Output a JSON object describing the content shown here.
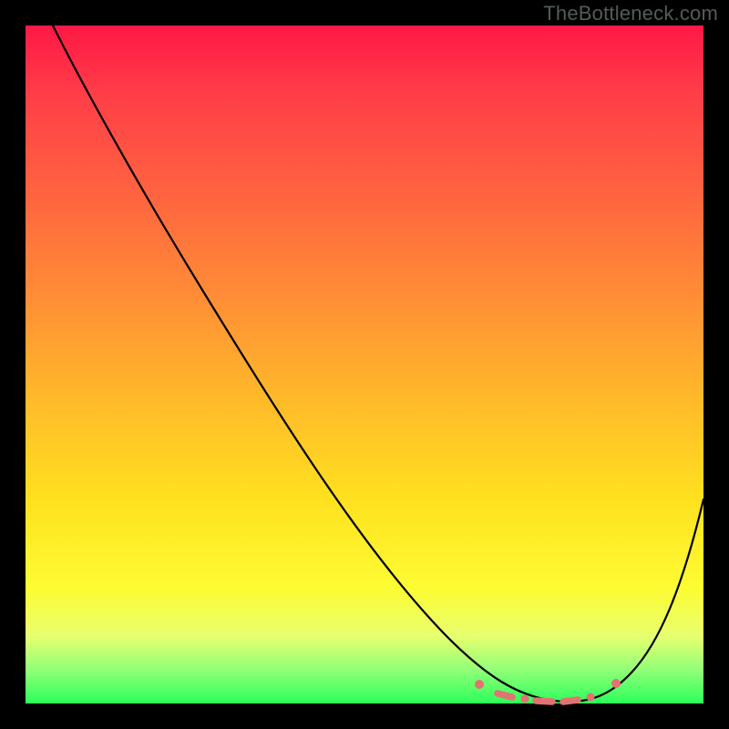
{
  "attribution": "TheBottleneck.com",
  "colors": {
    "frame": "#000000",
    "curve": "#000000",
    "marker": "#e37272",
    "gradient_stops": [
      "#ff1845",
      "#ff3d48",
      "#ff6440",
      "#ff8d36",
      "#ffb92a",
      "#ffe11f",
      "#fdfc33",
      "#e8ff6e",
      "#92ff78",
      "#2bff5a"
    ]
  },
  "chart_data": {
    "type": "line",
    "title": "",
    "xlabel": "",
    "ylabel": "",
    "xlim": [
      0,
      100
    ],
    "ylim": [
      0,
      100
    ],
    "grid": false,
    "legend": false,
    "series": [
      {
        "name": "bottleneck-curve",
        "x": [
          4,
          10,
          20,
          30,
          40,
          50,
          60,
          66,
          70,
          74,
          78,
          82,
          86,
          90,
          94,
          100
        ],
        "values": [
          100,
          91,
          77,
          63,
          49,
          35,
          21,
          12,
          6,
          3,
          1,
          1,
          2,
          6,
          12,
          31
        ]
      }
    ],
    "marker_band": {
      "name": "optimal-range-markers",
      "x_start": 66,
      "x_end": 86,
      "y_approx": 1
    }
  }
}
